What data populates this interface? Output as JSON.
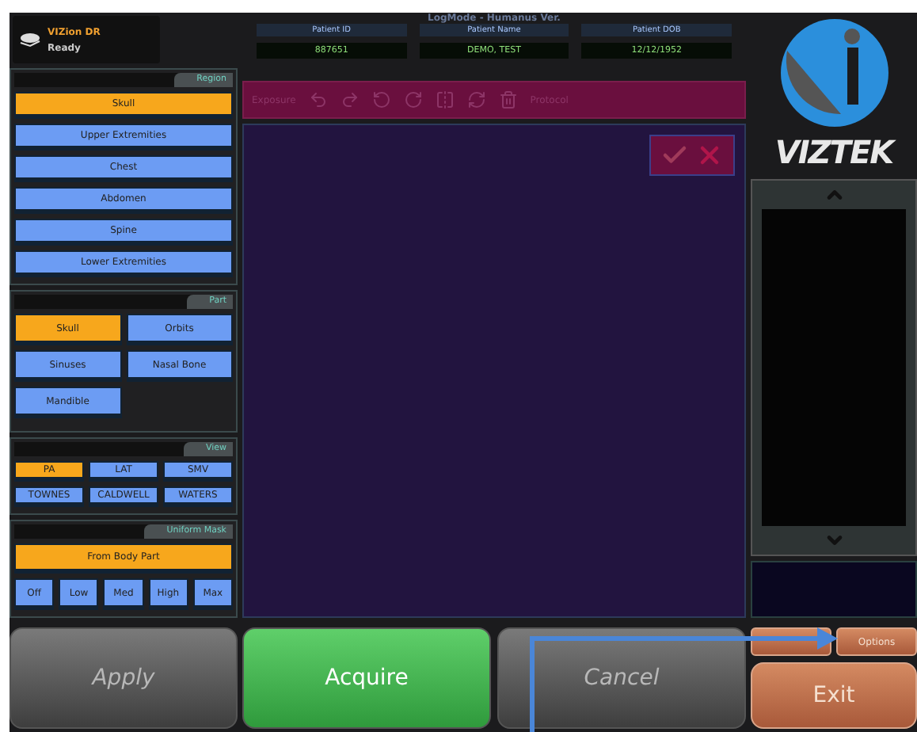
{
  "status": {
    "device": "VIZion DR",
    "state": "Ready"
  },
  "log_mode": "LogMode - Humanus Ver.",
  "patient": [
    {
      "label": "Patient ID",
      "value": "887651"
    },
    {
      "label": "Patient Name",
      "value": "DEMO, TEST"
    },
    {
      "label": "Patient DOB",
      "value": "12/12/1952"
    }
  ],
  "region": {
    "title": "Region",
    "items": [
      {
        "label": "Skull",
        "selected": true
      },
      {
        "label": "Upper Extremities",
        "selected": false
      },
      {
        "label": "Chest",
        "selected": false
      },
      {
        "label": "Abdomen",
        "selected": false
      },
      {
        "label": "Spine",
        "selected": false
      },
      {
        "label": "Lower Extremities",
        "selected": false
      }
    ]
  },
  "part": {
    "title": "Part",
    "items": [
      {
        "label": "Skull",
        "selected": true
      },
      {
        "label": "Orbits",
        "selected": false
      },
      {
        "label": "Sinuses",
        "selected": false
      },
      {
        "label": "Nasal Bone",
        "selected": false
      },
      {
        "label": "Mandible",
        "selected": false
      }
    ]
  },
  "view": {
    "title": "View",
    "items": [
      {
        "label": "PA",
        "selected": true
      },
      {
        "label": "LAT",
        "selected": false
      },
      {
        "label": "SMV",
        "selected": false
      },
      {
        "label": "TOWNES",
        "selected": false
      },
      {
        "label": "CALDWELL",
        "selected": false
      },
      {
        "label": "WATERS",
        "selected": false
      }
    ]
  },
  "mask": {
    "title": "Uniform Mask",
    "source": {
      "label": "From Body Part",
      "selected": true
    },
    "levels": [
      {
        "label": "Off",
        "selected": false
      },
      {
        "label": "Low",
        "selected": false
      },
      {
        "label": "Med",
        "selected": false
      },
      {
        "label": "High",
        "selected": false
      },
      {
        "label": "Max",
        "selected": false
      }
    ]
  },
  "toolbar": {
    "left_label": "Exposure",
    "right_label": "Protocol"
  },
  "logo": {
    "text": "VIZTEK"
  },
  "actions": [
    {
      "label": "Apply",
      "kind": "disabled"
    },
    {
      "label": "Acquire",
      "kind": "primary"
    },
    {
      "label": "Cancel",
      "kind": "disabled"
    }
  ],
  "options": "Options",
  "exit": "Exit"
}
